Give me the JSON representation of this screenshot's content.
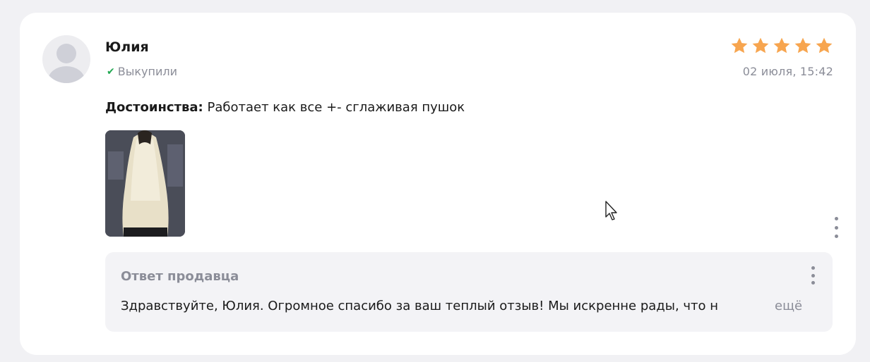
{
  "review": {
    "author": "Юлия",
    "purchase_status": "Выкупили",
    "date": "02 июля, 15:42",
    "rating": 5,
    "rating_max": 5,
    "star_color": "#f7a54f",
    "pros_label": "Достоинства:",
    "pros_text": " Работает как все +- сглаживая пушок"
  },
  "seller_reply": {
    "title": "Ответ продавца",
    "text": "Здравствуйте, Юлия. Огромное спасибо за ваш теплый отзыв! Мы искренне рады, что н",
    "more_label": "ещё"
  },
  "icons": {
    "avatar": "user-placeholder-icon",
    "check": "checkmark-icon",
    "star": "star-icon",
    "menu": "kebab-menu-icon",
    "cursor": "mouse-pointer-icon"
  }
}
